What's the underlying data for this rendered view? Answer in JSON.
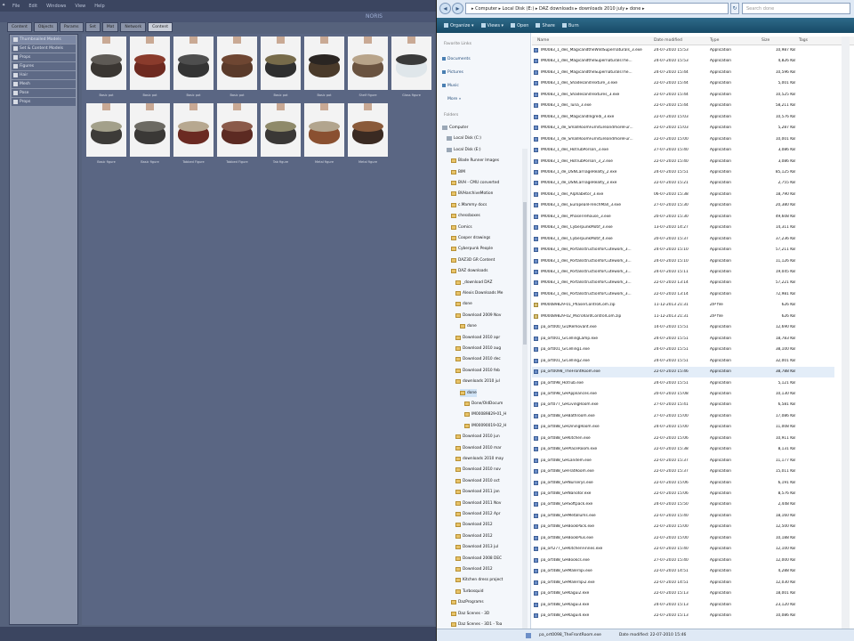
{
  "app": {
    "menu": [
      "File",
      "Edit",
      "Windows",
      "View",
      "Help"
    ],
    "header_label": "NORIS",
    "tabs": [
      "Content",
      "Objects",
      "Params",
      "Set",
      "Mat",
      "Network",
      "Content"
    ],
    "sidebar": [
      "Thumbnailed Models",
      "Set & Content Models",
      "Props",
      "Figures",
      "Hair",
      "Mesh",
      "Pose",
      "Props"
    ],
    "thumbnails_row1": [
      {
        "caption": "Basic pot",
        "color": "#3a3632",
        "accent": "#5e5a55"
      },
      {
        "caption": "Basic pot",
        "color": "#6e2a20",
        "accent": "#8a3b2c"
      },
      {
        "caption": "Basic pot",
        "color": "#343434",
        "accent": "#4e4e4e"
      },
      {
        "caption": "Basic pot",
        "color": "#5a3a2a",
        "accent": "#6e4632"
      },
      {
        "caption": "Basic pot",
        "color": "#2f2f2f",
        "accent": "#776b4a"
      },
      {
        "caption": "Basic pot",
        "color": "#4a3a2a",
        "accent": "#2a2522"
      },
      {
        "caption": "Shelf figure",
        "color": "#6a5340",
        "accent": "#b8a48a"
      },
      {
        "caption": "Glass figure",
        "color": "#dfe6ea",
        "accent": "#3a3a3a"
      }
    ],
    "thumbnails_row2": [
      {
        "caption": "Basic figure",
        "color": "#3d3b38",
        "accent": "#a3a08a"
      },
      {
        "caption": "Basic figure",
        "color": "#3a3836",
        "accent": "#6c6a63"
      },
      {
        "caption": "Tabbed Figure",
        "color": "#6b2a22",
        "accent": "#b7a890"
      },
      {
        "caption": "Tabbed Figure",
        "color": "#5c2a22",
        "accent": "#8a5a4a"
      },
      {
        "caption": "Tab figure",
        "color": "#3a3836",
        "accent": "#8f8a6a"
      },
      {
        "caption": "Metal figure",
        "color": "#8a5030",
        "accent": "#b2a58e"
      },
      {
        "caption": "Metal figure",
        "color": "#3a2a22",
        "accent": "#8a5a3a"
      }
    ]
  },
  "explorer": {
    "address": "▸ Computer ▸ Local Disk (E:) ▸ DAZ downloads ▸ downloads 2010 july ▸ done ▸",
    "search_placeholder": "Search done",
    "toolbar": [
      "Organize ▾",
      "Views ▾",
      "Open",
      "Share",
      "Burn"
    ],
    "favorite_links_title": "Favorite Links",
    "favorite_links": [
      "Documents",
      "Pictures",
      "Music",
      "More »"
    ],
    "folders_title": "Folders",
    "tree": [
      {
        "label": "Computer",
        "indent": 0,
        "kind": "drive"
      },
      {
        "label": "Local Disk (C:)",
        "indent": 1,
        "kind": "drive"
      },
      {
        "label": "Local Disk (E:)",
        "indent": 1,
        "kind": "drive"
      },
      {
        "label": "Blade Runner Images",
        "indent": 2,
        "kind": "folder"
      },
      {
        "label": "BIM",
        "indent": 2,
        "kind": "folder"
      },
      {
        "label": "BVH - CMU converted",
        "indent": 2,
        "kind": "folder"
      },
      {
        "label": "BVHarchiveMotion",
        "indent": 2,
        "kind": "folder"
      },
      {
        "label": "c.Mammy docs",
        "indent": 2,
        "kind": "folder"
      },
      {
        "label": "chessboxes",
        "indent": 2,
        "kind": "folder"
      },
      {
        "label": "Comics",
        "indent": 2,
        "kind": "folder"
      },
      {
        "label": "Cooper drawings",
        "indent": 2,
        "kind": "folder"
      },
      {
        "label": "Cyberpunk People",
        "indent": 2,
        "kind": "folder"
      },
      {
        "label": "DAZ3D GR Content",
        "indent": 2,
        "kind": "folder"
      },
      {
        "label": "DAZ downloads",
        "indent": 2,
        "kind": "folder"
      },
      {
        "label": "_download DAZ",
        "indent": 3,
        "kind": "folder"
      },
      {
        "label": "Alexis Downloads Me",
        "indent": 3,
        "kind": "folder"
      },
      {
        "label": "done",
        "indent": 3,
        "kind": "folder"
      },
      {
        "label": "Download 2009 Nov",
        "indent": 3,
        "kind": "folder"
      },
      {
        "label": "done",
        "indent": 4,
        "kind": "folder"
      },
      {
        "label": "Download 2010 apr",
        "indent": 3,
        "kind": "folder"
      },
      {
        "label": "Download 2010 aug",
        "indent": 3,
        "kind": "folder"
      },
      {
        "label": "Download 2010 dec",
        "indent": 3,
        "kind": "folder"
      },
      {
        "label": "Download 2010 feb",
        "indent": 3,
        "kind": "folder"
      },
      {
        "label": "downloads 2010 jul",
        "indent": 3,
        "kind": "folder"
      },
      {
        "label": "done",
        "indent": 4,
        "kind": "folder"
      },
      {
        "label": "Done/OldDocum",
        "indent": 5,
        "kind": "folder"
      },
      {
        "label": "IM00089829-01_H",
        "indent": 5,
        "kind": "folder"
      },
      {
        "label": "IM00090019-02_H",
        "indent": 5,
        "kind": "folder"
      },
      {
        "label": "Download 2010 jun",
        "indent": 3,
        "kind": "folder"
      },
      {
        "label": "Download 2010 mar",
        "indent": 3,
        "kind": "folder"
      },
      {
        "label": "downloads 2010 may",
        "indent": 3,
        "kind": "folder"
      },
      {
        "label": "Download 2010 nov",
        "indent": 3,
        "kind": "folder"
      },
      {
        "label": "Download 2010 oct",
        "indent": 3,
        "kind": "folder"
      },
      {
        "label": "Download 2011 jan",
        "indent": 3,
        "kind": "folder"
      },
      {
        "label": "Download 2011 Nov",
        "indent": 3,
        "kind": "folder"
      },
      {
        "label": "Download 2012 Apr",
        "indent": 3,
        "kind": "folder"
      },
      {
        "label": "Download 2012",
        "indent": 3,
        "kind": "folder"
      },
      {
        "label": "Download 2012",
        "indent": 3,
        "kind": "folder"
      },
      {
        "label": "Download 2013 jul",
        "indent": 3,
        "kind": "folder"
      },
      {
        "label": "Download 2008 DEC",
        "indent": 3,
        "kind": "folder"
      },
      {
        "label": "Download 2012",
        "indent": 3,
        "kind": "folder"
      },
      {
        "label": "Kitchen dress project",
        "indent": 3,
        "kind": "folder"
      },
      {
        "label": "Turbosquid",
        "indent": 3,
        "kind": "folder"
      },
      {
        "label": "DazPrograms",
        "indent": 2,
        "kind": "folder"
      },
      {
        "label": "Daz Scenes - 3D",
        "indent": 2,
        "kind": "folder"
      },
      {
        "label": "Daz Scenes - 3D1 - Toa",
        "indent": 2,
        "kind": "folder"
      }
    ],
    "columns": [
      "Name",
      "Date modified",
      "Type",
      "Size",
      "Tags"
    ],
    "files": [
      {
        "name": "IM0083_1_des_MagicandtheWildSupernaturals_3.exe",
        "date": "24-07-2010 15:53",
        "type": "Application",
        "size": "10,987 KB"
      },
      {
        "name": "IM0083_1_des_MagicandtheSupernaturalsThe...",
        "date": "24-07-2010 15:53",
        "type": "Application",
        "size": "4,826 KB"
      },
      {
        "name": "IM0083_1_des_MagicandtheSupernaturalsThe...",
        "date": "24-07-2010 15:44",
        "type": "Application",
        "size": "10,596 KB"
      },
      {
        "name": "IM0083_1_des_ShadesandTexture_3.exe",
        "date": "22-07-2010 15:44",
        "type": "Application",
        "size": "5,001 KB"
      },
      {
        "name": "IM0083_1_des_ShadesandTextures_3.exe",
        "date": "22-07-2010 15:44",
        "type": "Application",
        "size": "10,525 KB"
      },
      {
        "name": "IM0083_1_des_Tuna_3.exe",
        "date": "22-07-2010 15:44",
        "type": "Application",
        "size": "58,211 KB"
      },
      {
        "name": "IM0083_1_des_MagicandIngredi_3.exe",
        "date": "22-07-2010 15:03",
        "type": "Application",
        "size": "10,576 KB"
      },
      {
        "name": "IM0083_1_de_SmallRoomFurnitureandmoreFur...",
        "date": "22-07-2010 15:03",
        "type": "Application",
        "size": "5,287 KB"
      },
      {
        "name": "IM0083_1_de_SmallRoomFurnitureandmoreFur...",
        "date": "22-07-2010 15:00",
        "type": "Application",
        "size": "10,001 KB"
      },
      {
        "name": "IM0083_1_des_HotTubPorson_3.exe",
        "date": "27-07-2010 15:40",
        "type": "Application",
        "size": "3,086 KB"
      },
      {
        "name": "IM0083_1_des_HotTubPorson_3_2.exe",
        "date": "22-07-2010 15:40",
        "type": "Application",
        "size": "3,086 KB"
      },
      {
        "name": "IM0083_1_de_DSNCarriageRealty_2.exe",
        "date": "24-07-2010 15:51",
        "type": "Application",
        "size": "85,125 KB"
      },
      {
        "name": "IM0083_1_de_DSNCarriageRealty_3.exe",
        "date": "22-07-2010 15:21",
        "type": "Application",
        "size": "2,755 KB"
      },
      {
        "name": "IM0083_1_des_Alphabetor_3.exe",
        "date": "06-07-2010 15:38",
        "type": "Application",
        "size": "18,790 KB"
      },
      {
        "name": "IM0083_1_des_EuropeanFrenchMall_3.exe",
        "date": "27-07-2010 15:30",
        "type": "Application",
        "size": "20,380 KB"
      },
      {
        "name": "IM0083_1_des_PhaseTrehouse_3.exe",
        "date": "20-07-2010 15:30",
        "type": "Application",
        "size": "49,608 KB"
      },
      {
        "name": "IM0083_1_des_CyberpunkMotif_3.exe",
        "date": "13-07-2010 14:27",
        "type": "Application",
        "size": "14,311 KB"
      },
      {
        "name": "IM0083_1_des_CyberpunkMotif_4.exe",
        "date": "20-07-2010 15:37",
        "type": "Application",
        "size": "37,236 KB"
      },
      {
        "name": "IM0083_1_des_PortalsstructionforCutework_3...",
        "date": "24-07-2010 15:10",
        "type": "Application",
        "size": "57,211 KB"
      },
      {
        "name": "IM0083_1_des_PortalsstructionforCutework_3...",
        "date": "24-07-2010 15:10",
        "type": "Application",
        "size": "11,126 KB"
      },
      {
        "name": "IM0083_1_des_PortalsstructionforCutework_3...",
        "date": "24-07-2010 15:11",
        "type": "Application",
        "size": "19,045 KB"
      },
      {
        "name": "IM0083_1_des_PortalsstructionforCutework_3...",
        "date": "22-07-2010 13:14",
        "type": "Application",
        "size": "57,221 KB"
      },
      {
        "name": "IM0083_1_des_PortalsstructionforCutework_3...",
        "date": "22-07-2010 13:14",
        "type": "Application",
        "size": "72,981 KB"
      },
      {
        "name": "IM00089829-01_PhaserControlCom.zip",
        "date": "11-12-2013 21:31",
        "type": "ZIP file",
        "size": "626 KB"
      },
      {
        "name": "IM00089829-02_MicrohardControlCom.zip",
        "date": "11-12-2013 21:31",
        "type": "ZIP file",
        "size": "626 KB"
      },
      {
        "name": "pa_ort000_GiDRemovant.exe",
        "date": "14-07-2010 15:51",
        "type": "Application",
        "size": "12,690 KB"
      },
      {
        "name": "pa_ort001_GiCellingLamp.exe",
        "date": "24-07-2010 15:51",
        "type": "Application",
        "size": "18,783 KB"
      },
      {
        "name": "pa_ort001_GiCelling1.exe",
        "date": "24-07-2010 15:51",
        "type": "Application",
        "size": "38,100 KB"
      },
      {
        "name": "pa_ort001_GiCelling2.exe",
        "date": "24-07-2010 15:51",
        "type": "Application",
        "size": "32,001 KB"
      },
      {
        "name": "pa_ort0098_TheFrontRoom.exe",
        "date": "22-07-2010 15:46",
        "type": "Application",
        "size": "38,788 KB"
      },
      {
        "name": "pa_ort098_HotTub.exe",
        "date": "24-07-2010 15:51",
        "type": "Application",
        "size": "5,121 KB"
      },
      {
        "name": "pa_ort098_GHAppliances.exe",
        "date": "20-07-2010 15:08",
        "type": "Application",
        "size": "10,130 KB"
      },
      {
        "name": "pa_ort077_GHLivingRoom.exe",
        "date": "27-07-2010 15:41",
        "type": "Application",
        "size": "6,581 KB"
      },
      {
        "name": "pa_ort088_GHBathroom.exe",
        "date": "27-07-2010 15:00",
        "type": "Application",
        "size": "17,086 KB"
      },
      {
        "name": "pa_ort088_GHDiningRoom.exe",
        "date": "24-07-2010 15:00",
        "type": "Application",
        "size": "11,008 KB"
      },
      {
        "name": "pa_ort088_GHKitchen.exe",
        "date": "22-07-2010 15:06",
        "type": "Application",
        "size": "10,911 KB"
      },
      {
        "name": "pa_ort088_GHPlaceRoom.exe",
        "date": "22-07-2010 15:38",
        "type": "Application",
        "size": "8,131 KB"
      },
      {
        "name": "pa_ort088_GHLandem.exe",
        "date": "22-07-2010 15:37",
        "type": "Application",
        "size": "11,177 KB"
      },
      {
        "name": "pa_ort088_GHFlatRoom.exe",
        "date": "22-07-2010 15:37",
        "type": "Application",
        "size": "15,011 KB"
      },
      {
        "name": "pa_ort088_GHNurserys.exe",
        "date": "22-07-2010 15:06",
        "type": "Application",
        "size": "6,191 KB"
      },
      {
        "name": "pa_ort088_GHNanotor.exe",
        "date": "22-07-2010 15:06",
        "type": "Application",
        "size": "8,576 KB"
      },
      {
        "name": "pa_ort088_GHSoftpack.exe",
        "date": "24-07-2010 15:50",
        "type": "Application",
        "size": "2,448 KB"
      },
      {
        "name": "pa_ort088_GHMetallums.exe",
        "date": "22-07-2010 15:40",
        "type": "Application",
        "size": "18,160 KB"
      },
      {
        "name": "pa_ort088_GHBookPack.exe",
        "date": "22-07-2010 15:00",
        "type": "Application",
        "size": "12,500 KB"
      },
      {
        "name": "pa_ort088_GHBookPlus.exe",
        "date": "22-07-2010 15:00",
        "type": "Application",
        "size": "10,188 KB"
      },
      {
        "name": "pa_ort277_GHKitchenFinnes.exe",
        "date": "22-07-2010 15:40",
        "type": "Application",
        "size": "12,100 KB"
      },
      {
        "name": "pa_ort488_GHBookcs.exe",
        "date": "27-07-2010 15:40",
        "type": "Application",
        "size": "12,000 KB"
      },
      {
        "name": "pa_ort488_GHMalerlipi.exe",
        "date": "22-07-2010 14:51",
        "type": "Application",
        "size": "4,288 KB"
      },
      {
        "name": "pa_ort488_GHMalerlipi2.exe",
        "date": "22-07-2010 14:51",
        "type": "Application",
        "size": "12,030 KB"
      },
      {
        "name": "pa_ort488_GHKagui2.exe",
        "date": "22-07-2010 15:13",
        "type": "Application",
        "size": "18,001 KB"
      },
      {
        "name": "pa_ort488_GHKagui3.exe",
        "date": "24-07-2010 15:13",
        "type": "Application",
        "size": "23,120 KB"
      },
      {
        "name": "pa_ort488_GHKagui4.exe",
        "date": "22-07-2010 15:13",
        "type": "Application",
        "size": "10,086 KB"
      }
    ],
    "status": {
      "selected": "pa_ort0098_TheFrontRoom.exe",
      "date_label": "Date modified: 22-07-2010 15:46",
      "type": "Application"
    }
  }
}
